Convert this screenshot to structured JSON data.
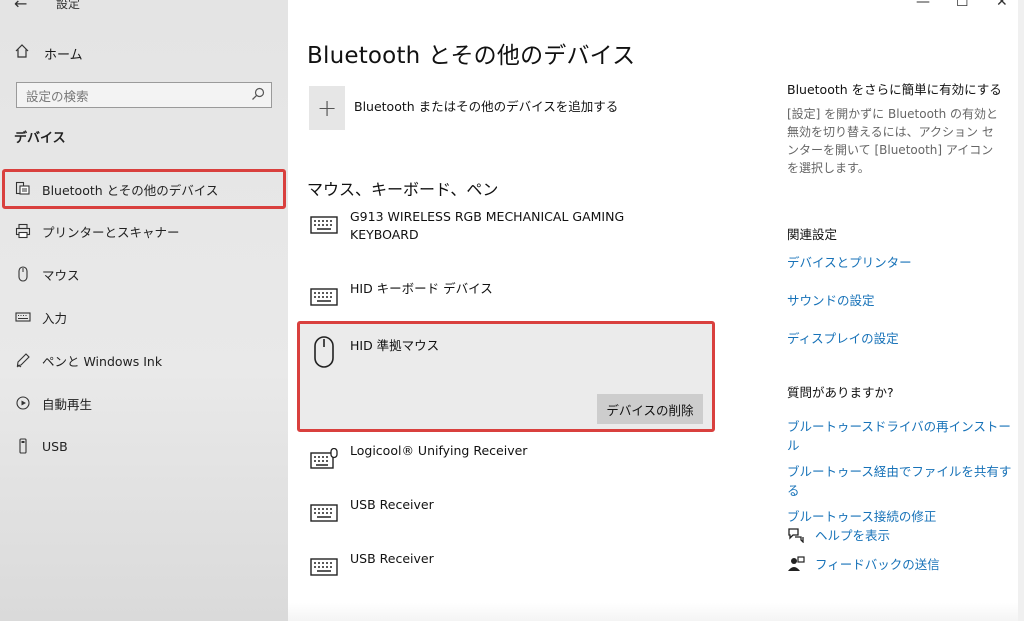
{
  "window": {
    "title": "設定",
    "minimize": "—",
    "maximize": "☐",
    "close": "✕"
  },
  "sidebar": {
    "home": "ホーム",
    "search_placeholder": "設定の検索",
    "section": "デバイス",
    "items": [
      {
        "label": "Bluetooth とその他のデバイス",
        "icon": "bluetooth-devices-icon",
        "selected": true
      },
      {
        "label": "プリンターとスキャナー",
        "icon": "printer-icon"
      },
      {
        "label": "マウス",
        "icon": "mouse-icon"
      },
      {
        "label": "入力",
        "icon": "keyboard-icon"
      },
      {
        "label": "ペンと Windows Ink",
        "icon": "pen-icon"
      },
      {
        "label": "自動再生",
        "icon": "autoplay-icon"
      },
      {
        "label": "USB",
        "icon": "usb-icon"
      }
    ]
  },
  "main": {
    "title": "Bluetooth とその他のデバイス",
    "add_device": "Bluetooth またはその他のデバイスを追加する",
    "section": "マウス、キーボード、ペン",
    "devices": [
      {
        "name": "G913 WIRELESS RGB MECHANICAL GAMING KEYBOARD",
        "icon": "keyboard-icon"
      },
      {
        "name": "HID キーボード デバイス",
        "icon": "keyboard-icon"
      },
      {
        "name": "HID 準拠マウス",
        "icon": "mouse-icon",
        "selected": true,
        "action": "デバイスの削除"
      },
      {
        "name": "Logicool® Unifying Receiver",
        "icon": "keyboard-mouse-icon"
      },
      {
        "name": "USB Receiver",
        "icon": "keyboard-icon"
      },
      {
        "name": "USB Receiver",
        "icon": "keyboard-icon"
      }
    ]
  },
  "right_panel": {
    "bt_head": "Bluetooth をさらに簡単に有効にする",
    "bt_text": "[設定] を開かずに Bluetooth の有効と無効を切り替えるには、アクション センターを開いて [Bluetooth] アイコンを選択します。",
    "related_head": "関連設定",
    "related_links": [
      "デバイスとプリンター",
      "サウンドの設定",
      "ディスプレイの設定"
    ],
    "question_head": "質問がありますか?",
    "question_links": [
      "ブルートゥースドライバの再インストール",
      "ブルートゥース経由でファイルを共有する",
      "ブルートゥース接続の修正"
    ],
    "help": "ヘルプを表示",
    "feedback": "フィードバックの送信"
  },
  "colors": {
    "accent_link": "#1772b8",
    "highlight_border": "#d9403e"
  }
}
